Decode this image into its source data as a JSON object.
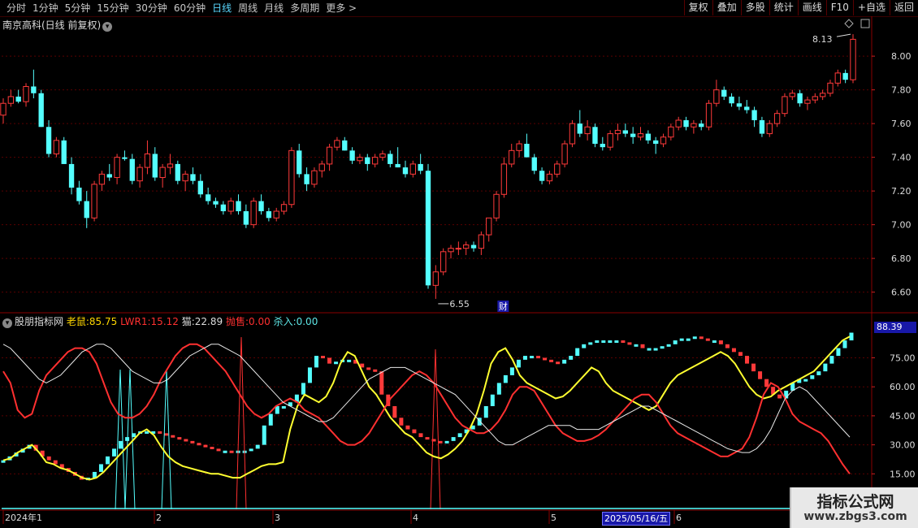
{
  "toolbar": {
    "periods": [
      "分时",
      "1分钟",
      "5分钟",
      "15分钟",
      "30分钟",
      "60分钟",
      "日线",
      "周线",
      "月线",
      "多周期",
      "更多 >"
    ],
    "active_period": "日线",
    "tools": [
      "复权",
      "叠加",
      "多股",
      "统计",
      "画线",
      "F10",
      "+自选",
      "返回"
    ]
  },
  "price_panel": {
    "title": "南京高科(日线 前复权)",
    "high_label": "8.13",
    "low_label": "6.55",
    "event_marker": "财",
    "y_ticks": [
      "8.00",
      "7.80",
      "7.60",
      "7.40",
      "7.20",
      "7.00",
      "6.80",
      "6.60"
    ]
  },
  "indicator_panel": {
    "source": "股朋指标网",
    "items": [
      {
        "name": "老鼠:",
        "value": "85.75"
      },
      {
        "name": "LWR1:",
        "value": "15.12"
      },
      {
        "name": "猫:",
        "value": "22.89"
      },
      {
        "name": "抛售:",
        "value": "0.00"
      },
      {
        "name": "杀入:",
        "value": "0.00"
      }
    ],
    "current_value_badge": "88.39",
    "y_ticks": [
      "75.00",
      "60.00",
      "45.00",
      "30.00",
      "15.00"
    ]
  },
  "x_axis": {
    "labels": [
      "2024年1",
      "2",
      "3",
      "4",
      "5",
      "6"
    ],
    "cursor_date": "2025/05/16/五"
  },
  "watermark": {
    "line1": "指标公式网",
    "line2": "www.zbgs3.com"
  },
  "colors": {
    "up": "#ff3a3a",
    "down": "#54ffff",
    "bg": "#000000",
    "grid": "#5a0000",
    "yellow": "#ffff30",
    "white": "#e8e8e8"
  },
  "chart_data": [
    {
      "type": "candlestick",
      "ylim": [
        6.55,
        8.15
      ],
      "candles_ohlc": [
        [
          7.65,
          7.75,
          7.6,
          7.72
        ],
        [
          7.72,
          7.8,
          7.7,
          7.76
        ],
        [
          7.76,
          7.8,
          7.72,
          7.73
        ],
        [
          7.73,
          7.84,
          7.7,
          7.82
        ],
        [
          7.82,
          7.92,
          7.75,
          7.78
        ],
        [
          7.78,
          7.8,
          7.58,
          7.58
        ],
        [
          7.58,
          7.62,
          7.4,
          7.42
        ],
        [
          7.42,
          7.52,
          7.4,
          7.5
        ],
        [
          7.5,
          7.52,
          7.36,
          7.36
        ],
        [
          7.36,
          7.4,
          7.18,
          7.22
        ],
        [
          7.22,
          7.26,
          7.12,
          7.14
        ],
        [
          7.14,
          7.2,
          6.98,
          7.04
        ],
        [
          7.04,
          7.26,
          7.02,
          7.24
        ],
        [
          7.24,
          7.32,
          7.2,
          7.3
        ],
        [
          7.3,
          7.36,
          7.26,
          7.28
        ],
        [
          7.28,
          7.42,
          7.24,
          7.4
        ],
        [
          7.4,
          7.44,
          7.38,
          7.39
        ],
        [
          7.39,
          7.42,
          7.24,
          7.26
        ],
        [
          7.26,
          7.36,
          7.22,
          7.34
        ],
        [
          7.34,
          7.5,
          7.3,
          7.42
        ],
        [
          7.42,
          7.46,
          7.26,
          7.28
        ],
        [
          7.28,
          7.36,
          7.22,
          7.34
        ],
        [
          7.34,
          7.42,
          7.3,
          7.36
        ],
        [
          7.36,
          7.38,
          7.24,
          7.26
        ],
        [
          7.26,
          7.32,
          7.2,
          7.3
        ],
        [
          7.3,
          7.34,
          7.24,
          7.26
        ],
        [
          7.26,
          7.3,
          7.16,
          7.18
        ],
        [
          7.18,
          7.22,
          7.12,
          7.14
        ],
        [
          7.14,
          7.16,
          7.1,
          7.12
        ],
        [
          7.12,
          7.14,
          7.06,
          7.08
        ],
        [
          7.08,
          7.16,
          7.06,
          7.14
        ],
        [
          7.14,
          7.18,
          7.06,
          7.08
        ],
        [
          7.08,
          7.12,
          6.98,
          7.0
        ],
        [
          7.0,
          7.16,
          6.98,
          7.14
        ],
        [
          7.14,
          7.18,
          7.06,
          7.08
        ],
        [
          7.08,
          7.1,
          7.02,
          7.04
        ],
        [
          7.04,
          7.1,
          7.02,
          7.08
        ],
        [
          7.08,
          7.14,
          7.06,
          7.12
        ],
        [
          7.12,
          7.46,
          7.1,
          7.44
        ],
        [
          7.44,
          7.48,
          7.28,
          7.3
        ],
        [
          7.3,
          7.34,
          7.2,
          7.24
        ],
        [
          7.24,
          7.34,
          7.22,
          7.32
        ],
        [
          7.32,
          7.38,
          7.28,
          7.36
        ],
        [
          7.36,
          7.48,
          7.32,
          7.46
        ],
        [
          7.46,
          7.52,
          7.44,
          7.5
        ],
        [
          7.5,
          7.52,
          7.44,
          7.44
        ],
        [
          7.44,
          7.46,
          7.36,
          7.38
        ],
        [
          7.38,
          7.42,
          7.36,
          7.4
        ],
        [
          7.4,
          7.42,
          7.32,
          7.36
        ],
        [
          7.36,
          7.42,
          7.34,
          7.4
        ],
        [
          7.4,
          7.44,
          7.38,
          7.42
        ],
        [
          7.42,
          7.44,
          7.34,
          7.36
        ],
        [
          7.36,
          7.46,
          7.34,
          7.34
        ],
        [
          7.34,
          7.38,
          7.28,
          7.3
        ],
        [
          7.3,
          7.38,
          7.28,
          7.36
        ],
        [
          7.36,
          7.42,
          7.3,
          7.32
        ],
        [
          7.32,
          7.36,
          6.62,
          6.64
        ],
        [
          6.64,
          6.76,
          6.56,
          6.72
        ],
        [
          6.72,
          6.86,
          6.7,
          6.84
        ],
        [
          6.84,
          6.88,
          6.8,
          6.86
        ],
        [
          6.86,
          6.9,
          6.82,
          6.86
        ],
        [
          6.86,
          6.9,
          6.82,
          6.88
        ],
        [
          6.88,
          6.9,
          6.84,
          6.86
        ],
        [
          6.86,
          6.96,
          6.82,
          6.94
        ],
        [
          6.94,
          7.04,
          6.9,
          7.04
        ],
        [
          7.04,
          7.2,
          7.02,
          7.18
        ],
        [
          7.18,
          7.4,
          7.16,
          7.36
        ],
        [
          7.36,
          7.48,
          7.34,
          7.44
        ],
        [
          7.44,
          7.5,
          7.4,
          7.48
        ],
        [
          7.48,
          7.54,
          7.4,
          7.4
        ],
        [
          7.4,
          7.42,
          7.3,
          7.32
        ],
        [
          7.32,
          7.34,
          7.24,
          7.26
        ],
        [
          7.26,
          7.32,
          7.24,
          7.3
        ],
        [
          7.3,
          7.38,
          7.28,
          7.36
        ],
        [
          7.36,
          7.5,
          7.34,
          7.48
        ],
        [
          7.48,
          7.62,
          7.46,
          7.6
        ],
        [
          7.6,
          7.68,
          7.52,
          7.54
        ],
        [
          7.54,
          7.62,
          7.5,
          7.58
        ],
        [
          7.58,
          7.6,
          7.46,
          7.48
        ],
        [
          7.48,
          7.52,
          7.44,
          7.46
        ],
        [
          7.46,
          7.56,
          7.44,
          7.54
        ],
        [
          7.54,
          7.6,
          7.5,
          7.56
        ],
        [
          7.56,
          7.6,
          7.52,
          7.54
        ],
        [
          7.54,
          7.58,
          7.48,
          7.52
        ],
        [
          7.52,
          7.58,
          7.5,
          7.54
        ],
        [
          7.54,
          7.56,
          7.48,
          7.5
        ],
        [
          7.5,
          7.52,
          7.42,
          7.48
        ],
        [
          7.48,
          7.54,
          7.46,
          7.52
        ],
        [
          7.52,
          7.6,
          7.5,
          7.58
        ],
        [
          7.58,
          7.64,
          7.56,
          7.62
        ],
        [
          7.62,
          7.64,
          7.56,
          7.58
        ],
        [
          7.58,
          7.62,
          7.54,
          7.6
        ],
        [
          7.6,
          7.62,
          7.56,
          7.58
        ],
        [
          7.58,
          7.74,
          7.56,
          7.72
        ],
        [
          7.72,
          7.86,
          7.7,
          7.8
        ],
        [
          7.8,
          7.82,
          7.74,
          7.76
        ],
        [
          7.76,
          7.78,
          7.7,
          7.72
        ],
        [
          7.72,
          7.76,
          7.68,
          7.7
        ],
        [
          7.7,
          7.74,
          7.66,
          7.68
        ],
        [
          7.68,
          7.7,
          7.58,
          7.62
        ],
        [
          7.62,
          7.64,
          7.52,
          7.54
        ],
        [
          7.54,
          7.62,
          7.52,
          7.6
        ],
        [
          7.6,
          7.68,
          7.58,
          7.66
        ],
        [
          7.66,
          7.78,
          7.64,
          7.76
        ],
        [
          7.76,
          7.8,
          7.74,
          7.78
        ],
        [
          7.78,
          7.8,
          7.7,
          7.72
        ],
        [
          7.72,
          7.76,
          7.68,
          7.74
        ],
        [
          7.74,
          7.78,
          7.72,
          7.76
        ],
        [
          7.76,
          7.8,
          7.74,
          7.78
        ],
        [
          7.78,
          7.86,
          7.76,
          7.84
        ],
        [
          7.84,
          7.92,
          7.82,
          7.9
        ],
        [
          7.9,
          7.92,
          7.84,
          7.86
        ],
        [
          7.86,
          8.13,
          7.84,
          8.1
        ]
      ]
    },
    {
      "type": "line",
      "ylim": [
        8,
        92
      ],
      "series": [
        {
          "name": "老鼠",
          "color": "#ffff30",
          "values": [
            22,
            23,
            26,
            28,
            30,
            26,
            21,
            20,
            18,
            17,
            15,
            13,
            12,
            13,
            16,
            20,
            24,
            28,
            32,
            36,
            38,
            35,
            29,
            24,
            21,
            19,
            18,
            17,
            16,
            15,
            15,
            14,
            13,
            13,
            15,
            17,
            19,
            20,
            20,
            21,
            38,
            50,
            56,
            54,
            52,
            55,
            62,
            72,
            78,
            76,
            68,
            60,
            56,
            50,
            44,
            40,
            36,
            34,
            30,
            26,
            24,
            23,
            25,
            28,
            32,
            38,
            46,
            58,
            72,
            78,
            80,
            74,
            66,
            62,
            60,
            58,
            56,
            54,
            55,
            58,
            62,
            66,
            70,
            68,
            62,
            58,
            56,
            54,
            52,
            50,
            48,
            50,
            56,
            62,
            66,
            68,
            70,
            72,
            74,
            76,
            78,
            76,
            72,
            66,
            60,
            56,
            54,
            55,
            58,
            60,
            62,
            64,
            66,
            68,
            72,
            76,
            80,
            84,
            86
          ]
        },
        {
          "name": "LWR1",
          "color": "#ff3030",
          "values": [
            68,
            62,
            48,
            44,
            46,
            58,
            66,
            70,
            74,
            78,
            80,
            80,
            78,
            72,
            62,
            52,
            46,
            44,
            44,
            46,
            50,
            56,
            64,
            70,
            76,
            80,
            82,
            82,
            80,
            76,
            72,
            68,
            62,
            56,
            50,
            46,
            44,
            46,
            50,
            52,
            54,
            52,
            48,
            46,
            44,
            40,
            36,
            32,
            30,
            30,
            32,
            36,
            42,
            48,
            54,
            58,
            62,
            66,
            68,
            66,
            62,
            56,
            50,
            44,
            40,
            38,
            36,
            36,
            38,
            42,
            48,
            56,
            60,
            60,
            58,
            52,
            46,
            40,
            36,
            34,
            32,
            32,
            33,
            35,
            38,
            42,
            46,
            50,
            54,
            56,
            56,
            52,
            46,
            40,
            36,
            34,
            32,
            30,
            28,
            26,
            24,
            24,
            26,
            28,
            34,
            44,
            56,
            62,
            60,
            54,
            46,
            42,
            40,
            38,
            36,
            32,
            26,
            20,
            15
          ]
        },
        {
          "name": "猫",
          "color": "#e8e8e8",
          "values": [
            82,
            80,
            76,
            72,
            68,
            64,
            62,
            64,
            66,
            70,
            74,
            78,
            80,
            82,
            82,
            80,
            76,
            72,
            68,
            66,
            64,
            62,
            62,
            64,
            68,
            72,
            76,
            78,
            80,
            82,
            82,
            80,
            78,
            76,
            72,
            68,
            64,
            60,
            56,
            52,
            50,
            48,
            46,
            44,
            42,
            42,
            44,
            48,
            52,
            56,
            60,
            64,
            66,
            68,
            70,
            70,
            70,
            68,
            66,
            64,
            62,
            60,
            58,
            56,
            52,
            48,
            44,
            40,
            36,
            32,
            30,
            30,
            32,
            34,
            36,
            38,
            40,
            40,
            40,
            40,
            38,
            38,
            38,
            38,
            40,
            42,
            44,
            46,
            48,
            50,
            50,
            48,
            46,
            44,
            42,
            40,
            38,
            36,
            34,
            32,
            30,
            28,
            27,
            26,
            26,
            28,
            32,
            38,
            46,
            54,
            58,
            60,
            58,
            54,
            50,
            46,
            42,
            38,
            34
          ]
        }
      ]
    },
    {
      "type": "bar",
      "name": "stacked blocks",
      "values": [
        22,
        24,
        26,
        28,
        30,
        27,
        24,
        22,
        20,
        18,
        16,
        14,
        12,
        13,
        16,
        20,
        24,
        28,
        32,
        34,
        36,
        37,
        37,
        37,
        36,
        35,
        34,
        33,
        32,
        31,
        30,
        29,
        28,
        27,
        27,
        26,
        27,
        27,
        28,
        30,
        40,
        46,
        50,
        50,
        52,
        56,
        62,
        70,
        76,
        75,
        72,
        73,
        74,
        74,
        72,
        70,
        69,
        68,
        56,
        50,
        44,
        40,
        38,
        36,
        34,
        33,
        32,
        31,
        32,
        34,
        36,
        38,
        40,
        44,
        50,
        56,
        62,
        66,
        70,
        74,
        76,
        76,
        75,
        74,
        73,
        72,
        74,
        76,
        80,
        82,
        83,
        84,
        84,
        84,
        84,
        83,
        82,
        82,
        80,
        80,
        80,
        81,
        82,
        84,
        85,
        85,
        86,
        85,
        84,
        84,
        82,
        80,
        78,
        76,
        72,
        68,
        64,
        60,
        56,
        54,
        58,
        62,
        64,
        64,
        66,
        68,
        72,
        76,
        80,
        84,
        88
      ]
    }
  ]
}
